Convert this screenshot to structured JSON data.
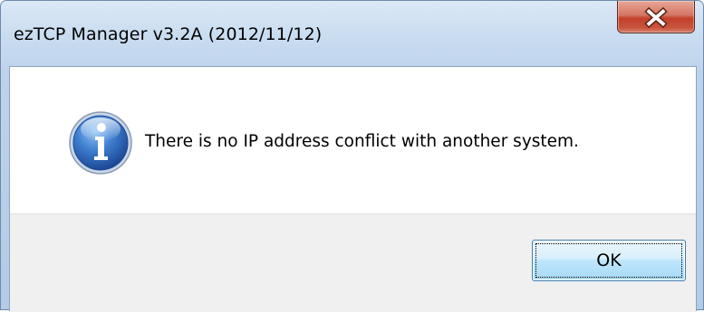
{
  "window": {
    "title": "ezTCP Manager v3.2A (2012/11/12)",
    "close_icon": "close-x-icon"
  },
  "message": {
    "icon": "info-icon",
    "text": "There is no IP address conflict with another system."
  },
  "buttons": {
    "ok_label": "OK"
  },
  "colors": {
    "close_button": "#c9553f",
    "info_icon": "#2d63b5",
    "ok_button_border": "#3c7fb1",
    "button_area": "#f0f0f0"
  }
}
